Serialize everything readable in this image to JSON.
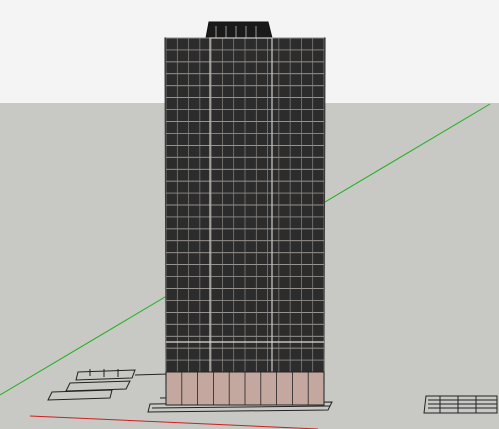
{
  "scene": {
    "sky_color": "#f4f4f4",
    "ground_color": "#c8c8c4",
    "axis_green_color": "#22b022",
    "axis_red_color": "#cc2020",
    "tower_body_color": "#2c2c2c",
    "tower_base_color": "#c4a8a0",
    "tower_lines_color": "#b8b4b0",
    "floors": 28,
    "window_columns": 14
  }
}
